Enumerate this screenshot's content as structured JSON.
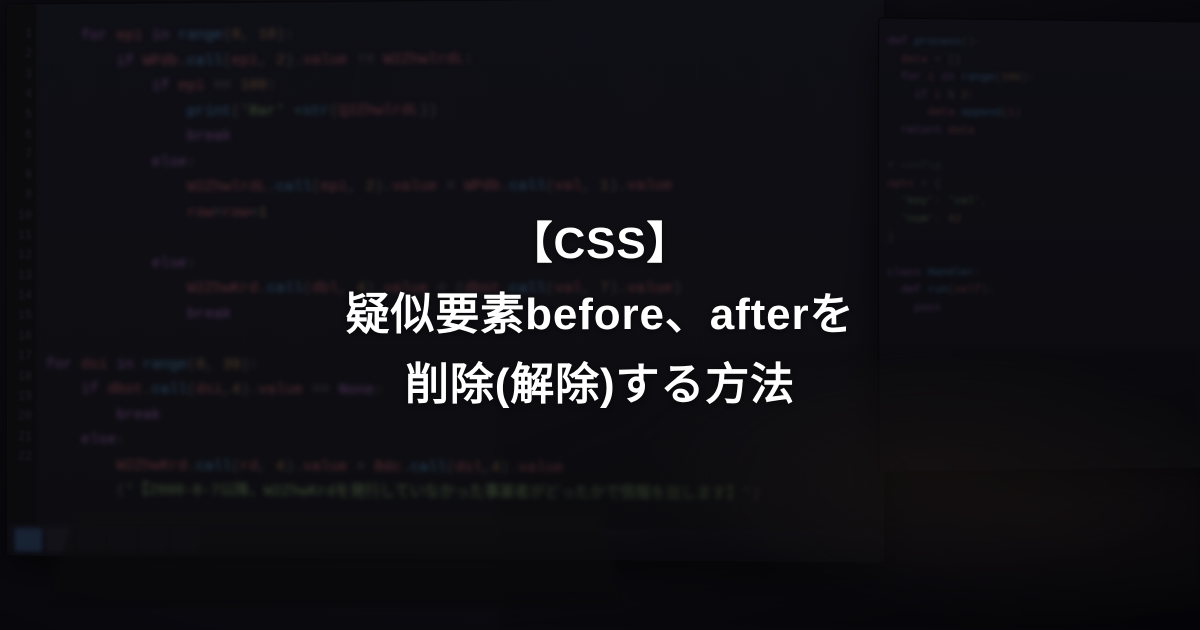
{
  "title": {
    "line1": "【CSS】",
    "line2": "疑似要素before、afterを",
    "line3": "削除(解除)する方法"
  }
}
